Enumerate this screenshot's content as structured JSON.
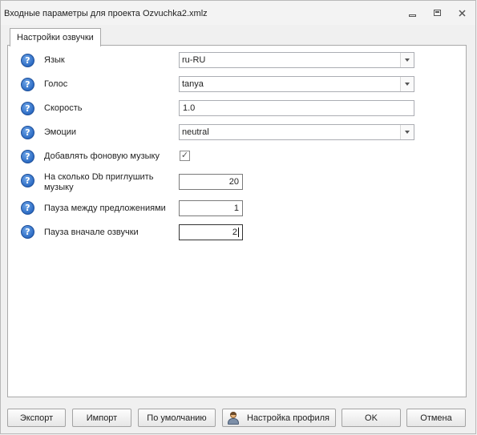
{
  "window": {
    "title": "Входные параметры для проекта Ozvuchka2.xmlz"
  },
  "tab": {
    "label": "Настройки озвучки"
  },
  "fields": {
    "language": {
      "label": "Язык",
      "value": "ru-RU"
    },
    "voice": {
      "label": "Голос",
      "value": "tanya"
    },
    "speed": {
      "label": "Скорость",
      "value": "1.0"
    },
    "emotions": {
      "label": "Эмоции",
      "value": "neutral"
    },
    "bg_music": {
      "label": "Добавлять фоновую музыку",
      "checked": true,
      "check_glyph": "✓"
    },
    "mute_db": {
      "label": "На сколько Db приглушить музыку",
      "value": "20"
    },
    "pause_sentences": {
      "label": "Пауза между предложениями",
      "value": "1"
    },
    "pause_start": {
      "label": "Пауза вначале озвучки",
      "value": "2"
    }
  },
  "help_icon_glyph": "?",
  "buttons": {
    "export": "Экспорт",
    "import": "Импорт",
    "default": "По умолчанию",
    "profile": "Настройка профиля",
    "ok": "OK",
    "cancel": "Отмена"
  },
  "icons": {
    "help": "help-icon",
    "profile": "user-icon",
    "minimize": "minimize-icon",
    "maximize": "maximize-icon",
    "close": "close-icon"
  }
}
